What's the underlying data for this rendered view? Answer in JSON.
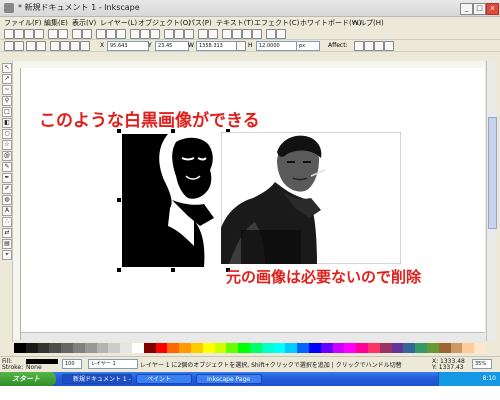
{
  "window": {
    "title": "* 新規ドキュメント 1 - Inkscape",
    "buttons": [
      "_",
      "□",
      "x"
    ]
  },
  "menu": {
    "items": [
      "ファイル(F)",
      "編集(E)",
      "表示(V)",
      "レイヤー(L)",
      "オブジェクト(O)",
      "パス(P)",
      "テキスト(T)",
      "エフェクト(C)",
      "ホワイトボード(W)",
      "ヘルプ(H)"
    ]
  },
  "tool_controls": {
    "x_value": "95.643",
    "y_value": "23.45",
    "w_value": "1358.313",
    "h_value": "12.0000",
    "units": "px",
    "label_x": "X",
    "label_y": "Y",
    "label_w": "W",
    "label_h": "H",
    "affect_label": "Affect:"
  },
  "canvas": {
    "caption_top": "このような白黒画像ができる",
    "caption_bottom": "元の画像は必要ないので削除"
  },
  "palette": {
    "colors": [
      "#000000",
      "#1a1a1a",
      "#333333",
      "#4d4d4d",
      "#666666",
      "#808080",
      "#999999",
      "#b3b3b3",
      "#cccccc",
      "#e6e6e6",
      "#ffffff",
      "#800000",
      "#ff0000",
      "#ff6600",
      "#ff9900",
      "#ffcc00",
      "#ffff00",
      "#ccff00",
      "#66ff00",
      "#00ff00",
      "#00ff66",
      "#00ffcc",
      "#00ffff",
      "#00ccff",
      "#0066ff",
      "#0000ff",
      "#6600ff",
      "#cc00ff",
      "#ff00ff",
      "#ff0099",
      "#ff3366",
      "#993366",
      "#663399",
      "#336699",
      "#339966",
      "#669933",
      "#996633",
      "#cc9966",
      "#ffcc99",
      "#ffe6cc"
    ]
  },
  "status": {
    "fill_label": "Fill:",
    "stroke_label": "Stroke:",
    "stroke_value": "None",
    "opacity": "100",
    "layer": "レイヤー 1",
    "message": "レイヤー 1 に2個のオブジェクトを選択, Shift+クリックで選択を追加 | クリックでハンドル切替",
    "coords_x": "X: 1333.48",
    "coords_y": "Y: 1337.43",
    "zoom": "35%"
  },
  "taskbar": {
    "start_label": "スタート",
    "tasks": [
      "新規ドキュメント 1 - ...",
      "ペイント",
      "Inkscape Page"
    ],
    "clock": "8:10"
  }
}
